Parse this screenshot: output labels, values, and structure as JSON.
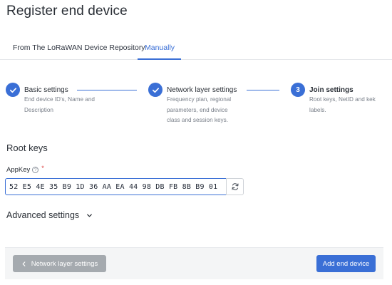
{
  "page": {
    "title": "Register end device"
  },
  "tabs": [
    {
      "label": "From The LoRaWAN Device Repository",
      "active": false
    },
    {
      "label": "Manually",
      "active": true
    }
  ],
  "steps": [
    {
      "indicator": "check",
      "title": "Basic settings",
      "desc_lines": [
        "End device ID's, Name and",
        "Description"
      ]
    },
    {
      "indicator": "check",
      "title": "Network layer settings",
      "desc_lines": [
        "Frequency plan, regional",
        "parameters, end device",
        "class and session keys."
      ]
    },
    {
      "indicator": "3",
      "title": "Join settings",
      "desc_lines": [
        "Root keys, NetID and kek",
        "labels."
      ]
    }
  ],
  "root_keys": {
    "section_title": "Root keys",
    "app_key": {
      "label": "AppKey",
      "required_marker": "*",
      "help_icon": "question-circle-icon",
      "value": "52 E5 4E 35 B9 1D 36 AA EA 44 98 DB FB 8B B9 01",
      "regenerate_icon": "refresh-icon"
    }
  },
  "advanced": {
    "label": "Advanced settings",
    "icon": "chevron-down-icon"
  },
  "footer": {
    "back_label": "Network layer settings",
    "back_icon": "chevron-left-icon",
    "submit_label": "Add end device"
  },
  "colors": {
    "accent": "#3a6fd6",
    "disabled_button": "#a5aaaf",
    "required": "#db3b3b"
  }
}
